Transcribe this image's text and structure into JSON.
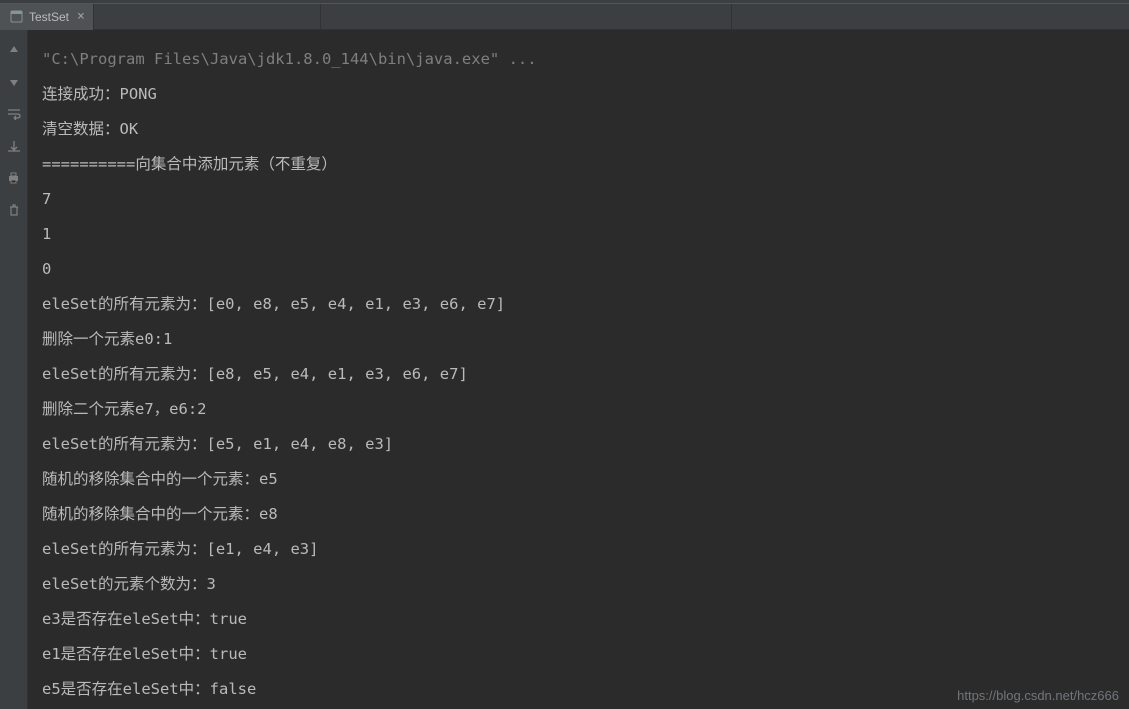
{
  "tab": {
    "label": "TestSet",
    "close": "×"
  },
  "console": {
    "lines": [
      "\"C:\\Program Files\\Java\\jdk1.8.0_144\\bin\\java.exe\" ...",
      "连接成功：PONG",
      "清空数据：OK",
      "==========向集合中添加元素（不重复）",
      "7",
      "1",
      "0",
      "eleSet的所有元素为：[e0, e8, e5, e4, e1, e3, e6, e7]",
      "删除一个元素e0:1",
      "eleSet的所有元素为：[e8, e5, e4, e1, e3, e6, e7]",
      "删除二个元素e7，e6:2",
      "eleSet的所有元素为：[e5, e1, e4, e8, e3]",
      "随机的移除集合中的一个元素：e5",
      "随机的移除集合中的一个元素：e8",
      "eleSet的所有元素为：[e1, e4, e3]",
      "eleSet的元素个数为：3",
      "e3是否存在eleSet中：true",
      "e1是否存在eleSet中：true",
      "e5是否存在eleSet中：false"
    ]
  },
  "watermark": "https://blog.csdn.net/hcz666"
}
